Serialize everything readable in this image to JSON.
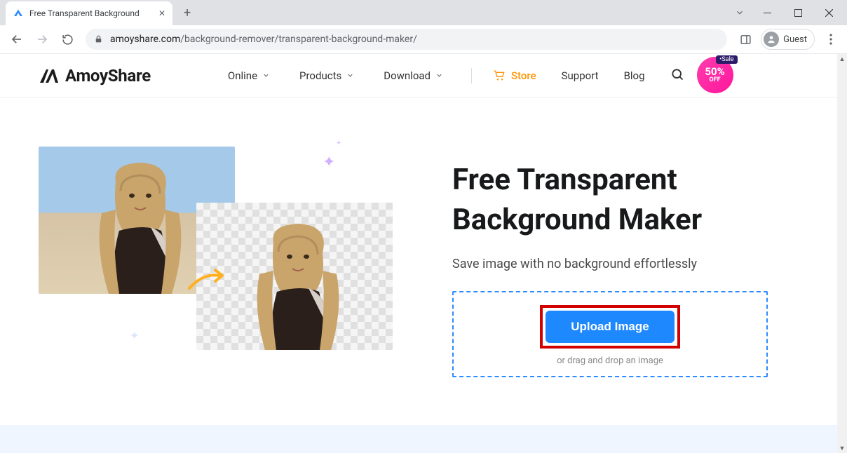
{
  "browser": {
    "tab_title": "Free Transparent Background",
    "url_host": "amoyshare.com",
    "url_path": "/background-remover/transparent-background-maker/",
    "guest_label": "Guest"
  },
  "header": {
    "brand": "AmoyShare",
    "nav": {
      "online": "Online",
      "products": "Products",
      "download": "Download",
      "store": "Store",
      "support": "Support",
      "blog": "Blog"
    },
    "sale": {
      "tag": "•Sale",
      "percent": "50%",
      "off": "OFF"
    }
  },
  "hero": {
    "title_line1": "Free Transparent",
    "title_line2": "Background Maker",
    "subtitle": "Save image with no background effortlessly",
    "upload_label": "Upload Image",
    "drag_hint": "or drag and drop an image"
  }
}
